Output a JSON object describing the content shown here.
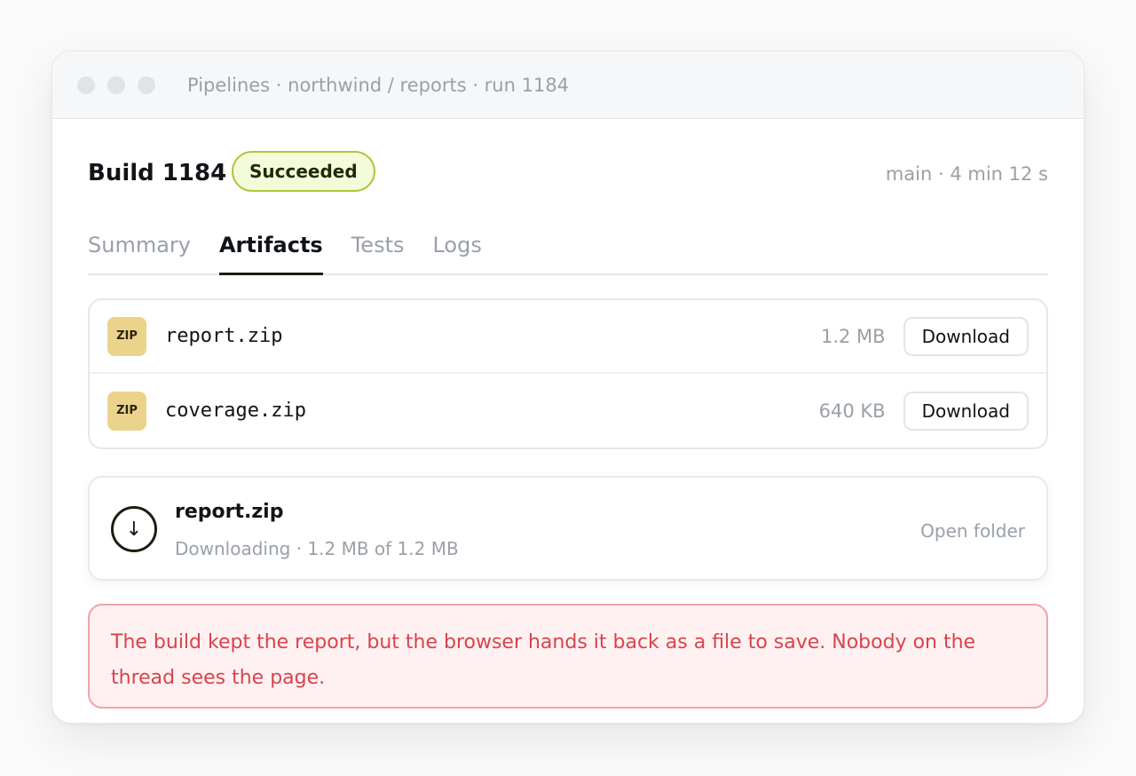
{
  "window": {
    "title": "Pipelines · northwind / reports · run 1184"
  },
  "header": {
    "build_title": "Build 1184",
    "status": "Succeeded",
    "meta": "main · 4 min 12 s"
  },
  "tabs": [
    {
      "label": "Summary",
      "active": false
    },
    {
      "label": "Artifacts",
      "active": true
    },
    {
      "label": "Tests",
      "active": false
    },
    {
      "label": "Logs",
      "active": false
    }
  ],
  "artifacts": [
    {
      "icon": "ZIP",
      "name": "report.zip",
      "size": "1.2 MB",
      "action": "Download"
    },
    {
      "icon": "ZIP",
      "name": "coverage.zip",
      "size": "640 KB",
      "action": "Download"
    }
  ],
  "download": {
    "icon": "↓",
    "file": "report.zip",
    "status": "Downloading · 1.2 MB of 1.2 MB",
    "action": "Open folder"
  },
  "notice": {
    "text": "The build kept the report, but the browser hands it back as a file to save. Nobody on the thread sees the page."
  },
  "colors": {
    "success_border": "#a9c93c",
    "success_bg": "#f4fbd8",
    "zip_icon_bg": "#ecd38b",
    "notice_text": "#d9434b",
    "notice_bg": "#fff1f2",
    "notice_border": "#efa3a8"
  }
}
